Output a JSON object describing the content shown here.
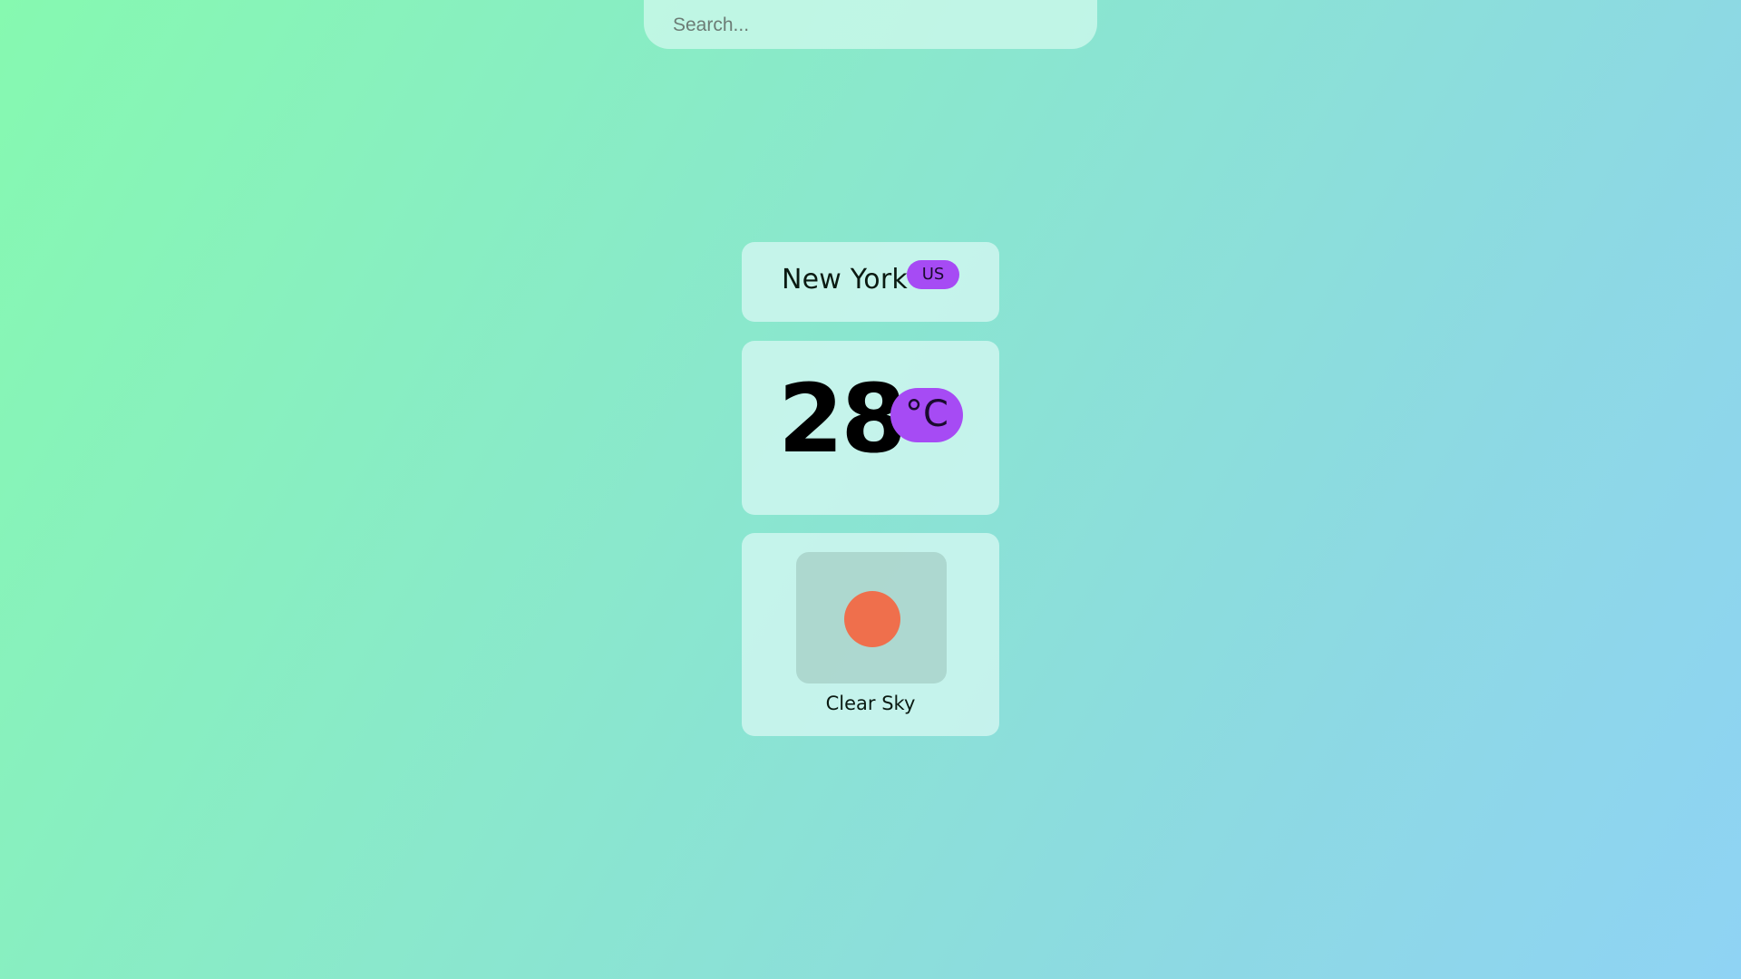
{
  "search": {
    "placeholder": "Search..."
  },
  "location": {
    "city": "New York",
    "country": "US"
  },
  "temperature": {
    "value": "28",
    "unit": "°C"
  },
  "condition": {
    "icon": "sun-icon",
    "description": "Clear Sky"
  },
  "colors": {
    "accent": "#a64bf4",
    "sun": "#ef6f4c",
    "card_background": "#d2f6f0"
  }
}
